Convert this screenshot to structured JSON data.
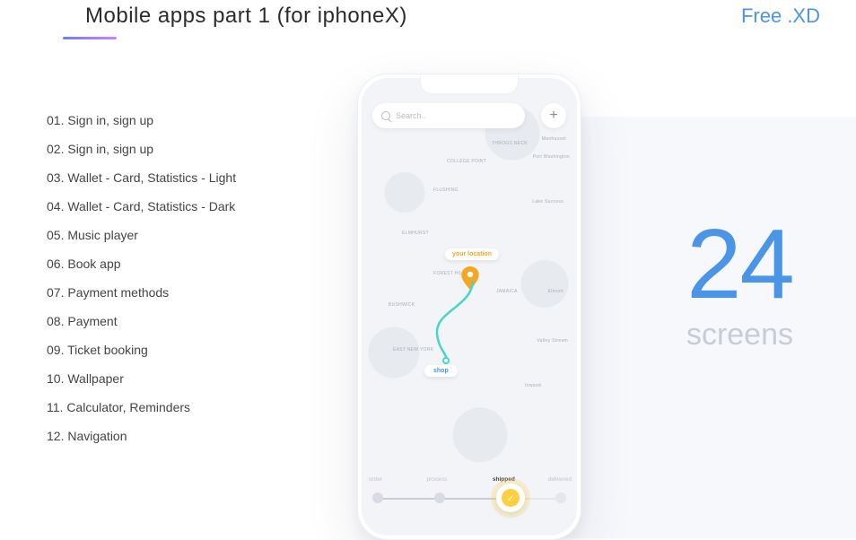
{
  "header": {
    "title": "Mobile apps part 1 (for iphoneX)",
    "badge": "Free .XD"
  },
  "list": [
    "01. Sign in, sign up",
    "02. Sign in, sign up",
    "03. Wallet - Card, Statistics - Light",
    "04. Wallet - Card, Statistics - Dark",
    "05. Music player",
    "06. Book app",
    "07. Payment methods",
    "08. Payment",
    "09. Ticket booking",
    "10. Wallpaper",
    "11. Calculator, Reminders",
    "12. Navigation"
  ],
  "phone": {
    "search_placeholder": "Search..",
    "location_chip": "your location",
    "shop_chip": "shop",
    "steps": {
      "s1": "order",
      "s2": "process",
      "s3": "shipped",
      "s4": "delivered"
    },
    "map_labels": [
      "COLLEGE POINT",
      "FLUSHING",
      "ELMHURST",
      "FOREST HILLS",
      "BUSHWICK",
      "JAMAICA",
      "Manhasset",
      "Port Washington",
      "Lake Success",
      "Elmont",
      "Valley Stream",
      "Inwood",
      "THROGS NECK",
      "EAST NEW YORK"
    ]
  },
  "stat": {
    "number": "24",
    "label": "screens"
  }
}
